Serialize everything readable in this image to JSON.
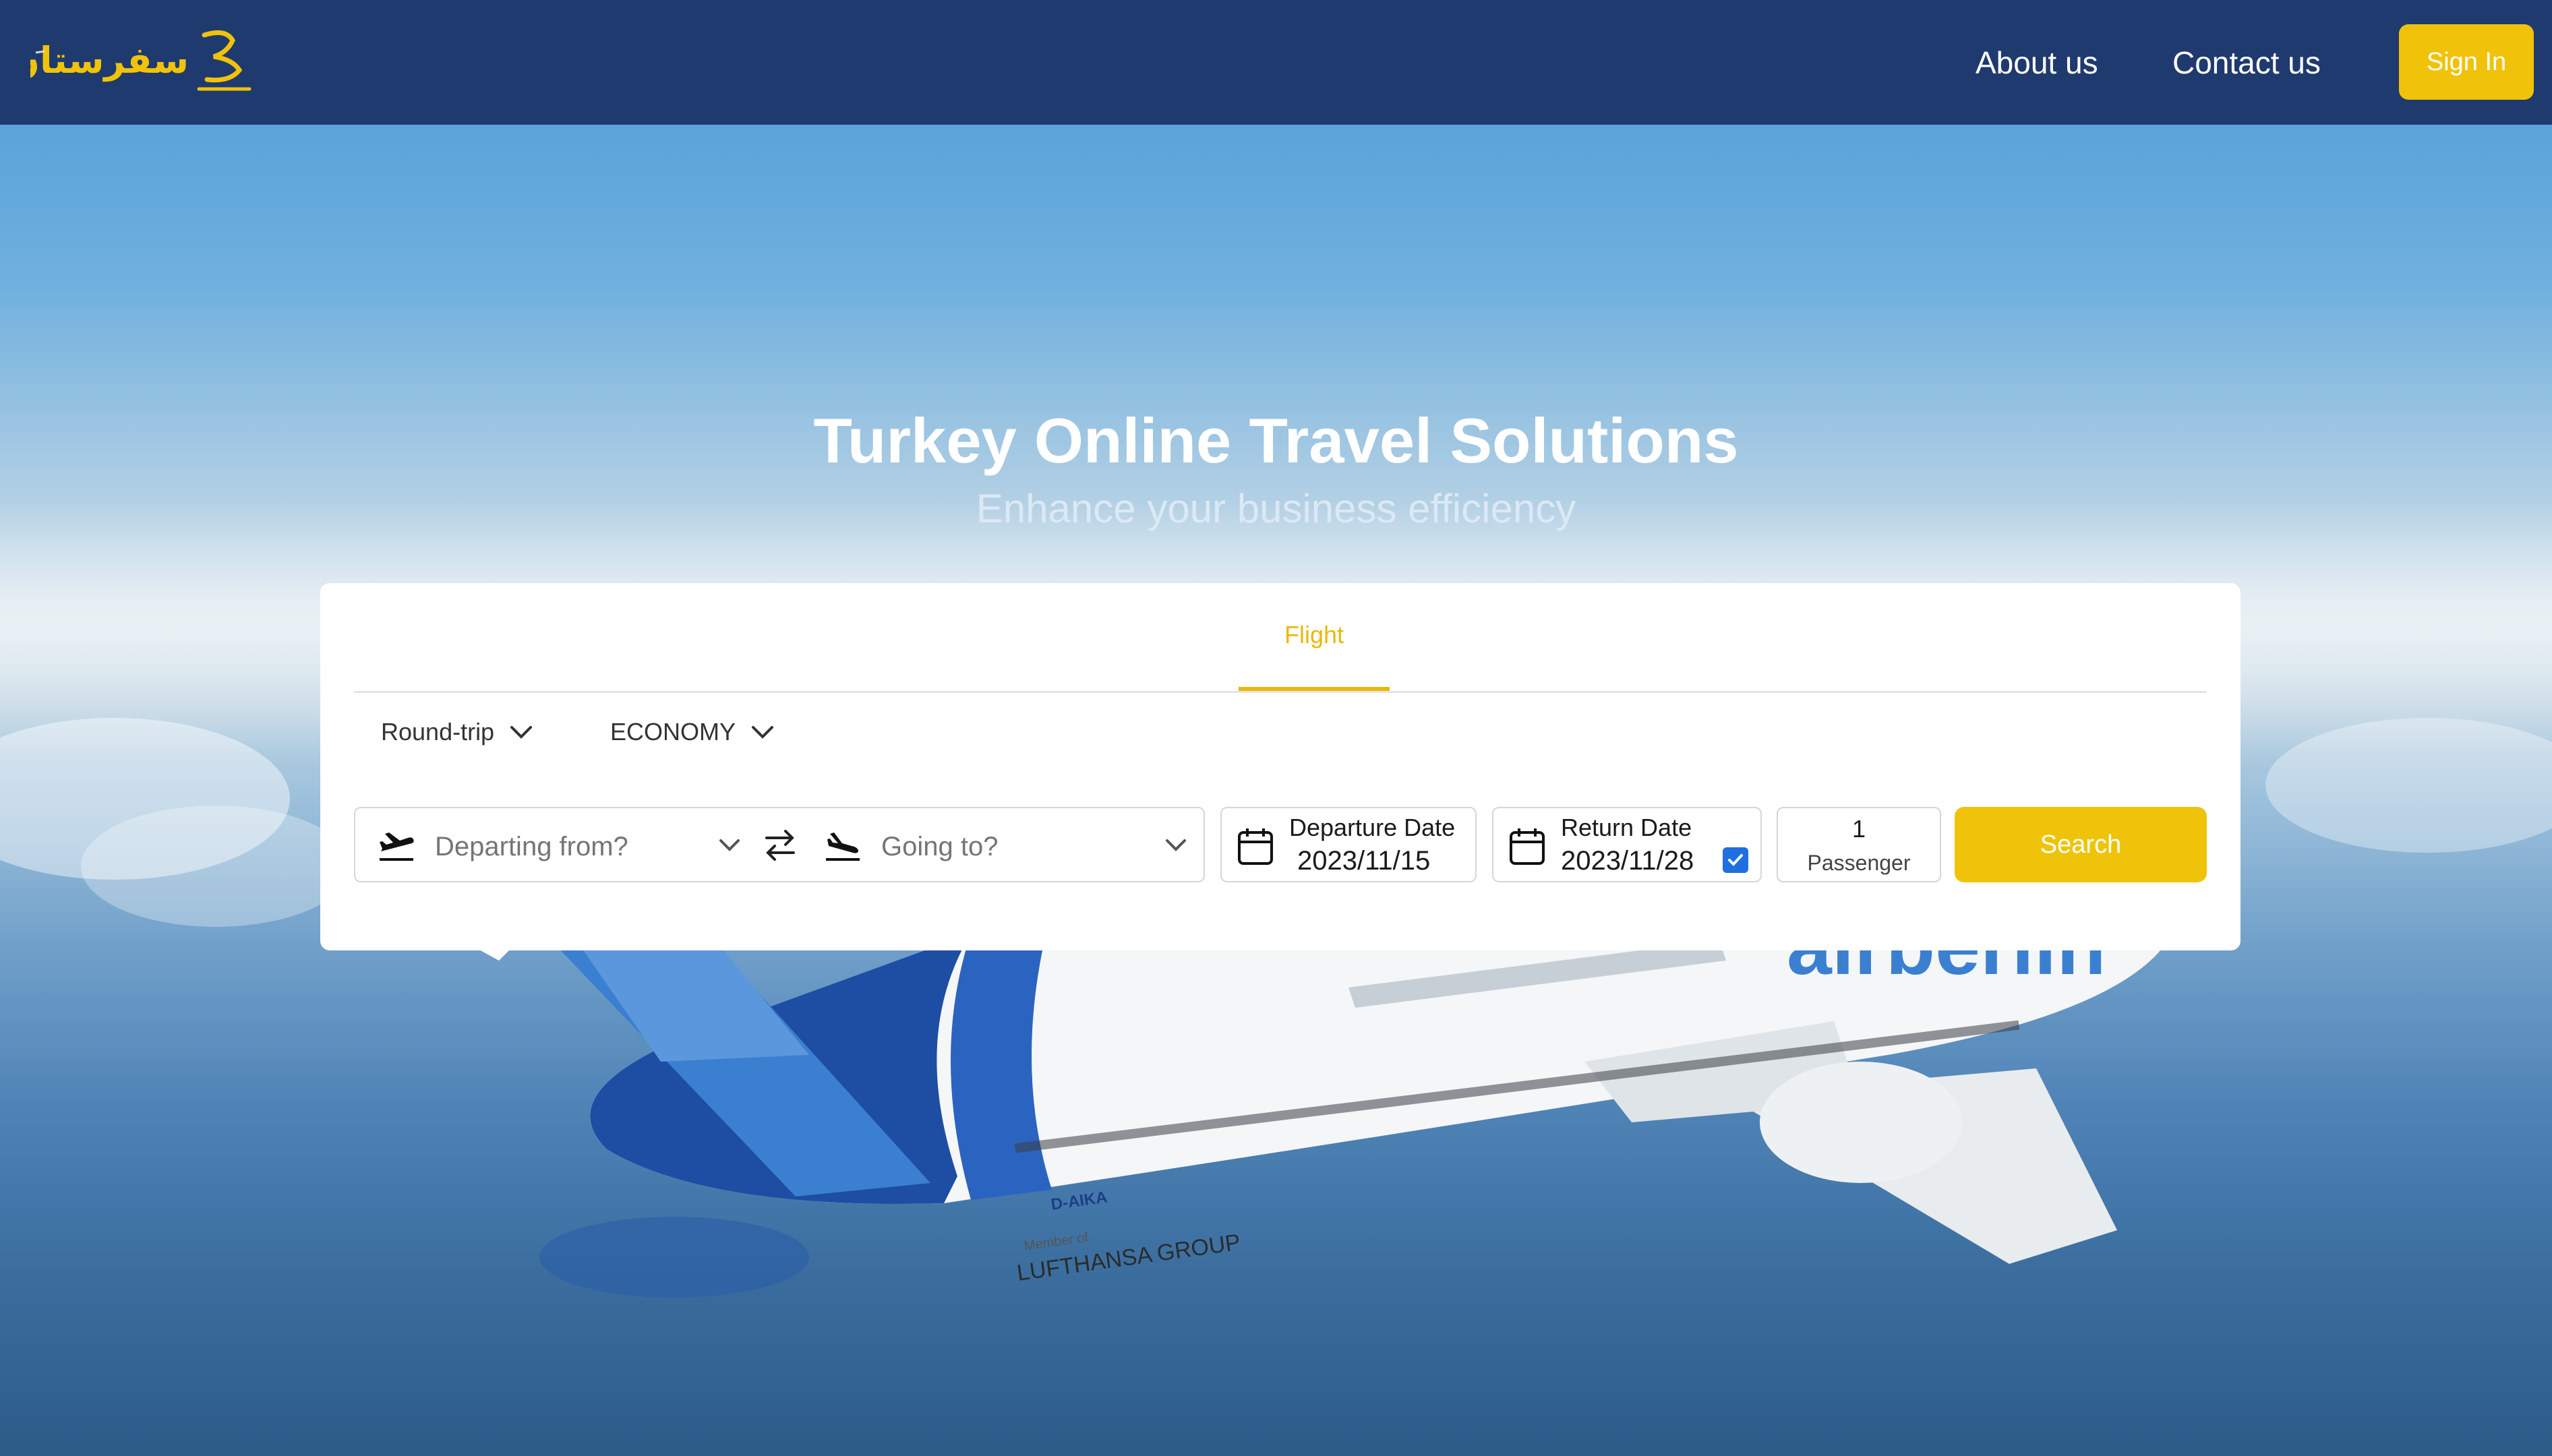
{
  "nav": {
    "logo_text": "سفرستان",
    "about_label": "About us",
    "contact_label": "Contact us",
    "signin_label": "Sign In"
  },
  "hero": {
    "title": "Turkey Online Travel Solutions",
    "subtitle": "Enhance your business efficiency"
  },
  "plane": {
    "registration": "D-AIKA",
    "livery_line1": "Member of",
    "livery_line2": "LUFTHANSA GROUP",
    "tail_text": "airberlin"
  },
  "search_card": {
    "tab": "Flight",
    "trip_type": "Round-trip",
    "cabin_class": "ECONOMY",
    "departing_placeholder": "Departing from?",
    "going_placeholder": "Going to?",
    "departure_label": "Departure Date",
    "departure_value": "2023/11/15",
    "return_label": "Return Date",
    "return_value": "2023/11/28",
    "return_checked": true,
    "passenger_count": "1",
    "passenger_label": "Passenger",
    "search_label": "Search"
  },
  "colors": {
    "navbar": "#1f3a6e",
    "accent": "#f0c30a",
    "checkbox": "#1f6fe0"
  },
  "icons": [
    "logo-icon",
    "chevron-down-icon",
    "takeoff-icon",
    "swap-icon",
    "landing-icon",
    "calendar-icon",
    "checkmark-icon"
  ]
}
